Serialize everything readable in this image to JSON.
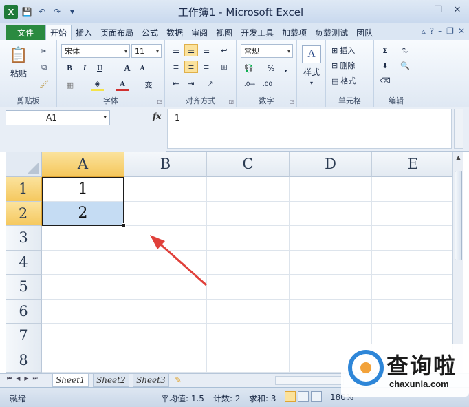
{
  "window": {
    "title": "工作簿1 - Microsoft Excel",
    "logo_letter": "X"
  },
  "window_controls": {
    "minimize": "—",
    "restore": "❐",
    "close": "✕"
  },
  "quick_access": {
    "save_icon": "💾",
    "undo_icon": "↶",
    "redo_icon": "↷",
    "customize_icon": "▾"
  },
  "tabs": {
    "file": "文件",
    "items": [
      "开始",
      "插入",
      "页面布局",
      "公式",
      "数据",
      "审阅",
      "视图",
      "开发工具",
      "加载项",
      "负载测试",
      "团队"
    ],
    "active_index": 0
  },
  "ribbon": {
    "clipboard": {
      "label": "剪贴板",
      "paste": "粘贴"
    },
    "font": {
      "label": "字体",
      "name": "宋体",
      "size": "11",
      "bold": "B",
      "italic": "I",
      "underline": "U",
      "grow": "A",
      "shrink": "A",
      "wen": "变"
    },
    "alignment": {
      "label": "对齐方式"
    },
    "number": {
      "label": "数字",
      "format": "常规",
      "percent": "%",
      "comma": ","
    },
    "styles": {
      "label": "样式",
      "button": "样式"
    },
    "cells": {
      "label": "单元格",
      "insert": "插入",
      "delete": "删除",
      "format": "格式"
    },
    "editing": {
      "label": "编辑",
      "sum": "Σ"
    }
  },
  "formula_bar": {
    "name_box": "A1",
    "fx": "fx",
    "content": "1"
  },
  "grid": {
    "columns": [
      "A",
      "B",
      "C",
      "D",
      "E"
    ],
    "rows": [
      "1",
      "2",
      "3",
      "4",
      "5",
      "6",
      "7",
      "8"
    ],
    "cells": {
      "A1": "1",
      "A2": "2"
    },
    "selected_range": "A1:A2"
  },
  "sheets": {
    "tabs": [
      "Sheet1",
      "Sheet2",
      "Sheet3"
    ],
    "active_index": 0
  },
  "status_bar": {
    "mode": "就绪",
    "average": "平均值: 1.5",
    "count": "计数: 2",
    "sum": "求和: 3",
    "zoom": "180%"
  },
  "watermark": {
    "title": "查询啦",
    "url": "chaxunla.com"
  },
  "colors": {
    "selection_fill": "#c5dcf3",
    "header_highlight": "#f5c85e",
    "file_tab": "#2a8a40",
    "annotation_arrow": "#e0403a"
  }
}
